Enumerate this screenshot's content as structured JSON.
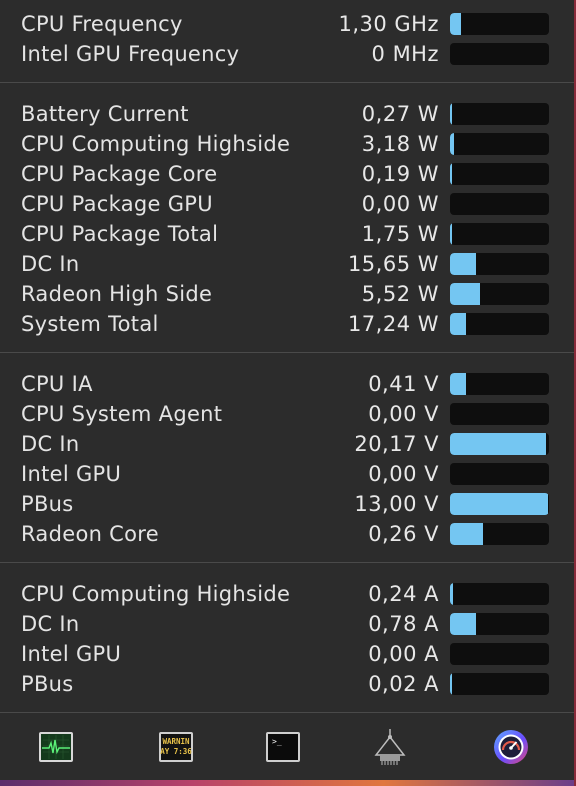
{
  "sections": [
    {
      "id": "frequency",
      "rows": [
        {
          "label": "CPU Frequency",
          "value": "1,30 GHz",
          "fill": 0.11
        },
        {
          "label": "Intel GPU Frequency",
          "value": "0 MHz",
          "fill": 0.0
        }
      ]
    },
    {
      "id": "power",
      "rows": [
        {
          "label": "Battery Current",
          "value": "0,27 W",
          "fill": 0.02
        },
        {
          "label": "CPU Computing Highside",
          "value": "3,18 W",
          "fill": 0.04
        },
        {
          "label": "CPU Package Core",
          "value": "0,19 W",
          "fill": 0.02
        },
        {
          "label": "CPU Package GPU",
          "value": "0,00 W",
          "fill": 0.0
        },
        {
          "label": "CPU Package Total",
          "value": "1,75 W",
          "fill": 0.02
        },
        {
          "label": "DC In",
          "value": "15,65 W",
          "fill": 0.26
        },
        {
          "label": "Radeon High Side",
          "value": "5,52 W",
          "fill": 0.3
        },
        {
          "label": "System Total",
          "value": "17,24 W",
          "fill": 0.16
        }
      ]
    },
    {
      "id": "voltage",
      "rows": [
        {
          "label": "CPU IA",
          "value": "0,41 V",
          "fill": 0.16
        },
        {
          "label": "CPU System Agent",
          "value": "0,00 V",
          "fill": 0.0
        },
        {
          "label": "DC In",
          "value": "20,17 V",
          "fill": 0.97
        },
        {
          "label": "Intel GPU",
          "value": "0,00 V",
          "fill": 0.0
        },
        {
          "label": "PBus",
          "value": "13,00 V",
          "fill": 0.99
        },
        {
          "label": "Radeon Core",
          "value": "0,26 V",
          "fill": 0.33
        }
      ]
    },
    {
      "id": "current",
      "rows": [
        {
          "label": "CPU Computing Highside",
          "value": "0,24 A",
          "fill": 0.03
        },
        {
          "label": "DC In",
          "value": "0,78 A",
          "fill": 0.26
        },
        {
          "label": "Intel GPU",
          "value": "0,00 A",
          "fill": 0.0
        },
        {
          "label": "PBus",
          "value": "0,02 A",
          "fill": 0.02
        }
      ]
    }
  ],
  "toolbar": {
    "items": [
      {
        "name": "activity-monitor-icon"
      },
      {
        "name": "console-icon",
        "text_line1": "WARNIN",
        "text_line2": "AY 7:36"
      },
      {
        "name": "terminal-icon",
        "prompt": ">_"
      },
      {
        "name": "system-information-icon"
      },
      {
        "name": "istat-menus-icon"
      }
    ]
  },
  "colors": {
    "background": "#2c2c2c",
    "bar_track": "#0e0e0e",
    "bar_fill": "#74c6f2",
    "text": "#e6e6e6",
    "separator": "#4a4a4a"
  }
}
